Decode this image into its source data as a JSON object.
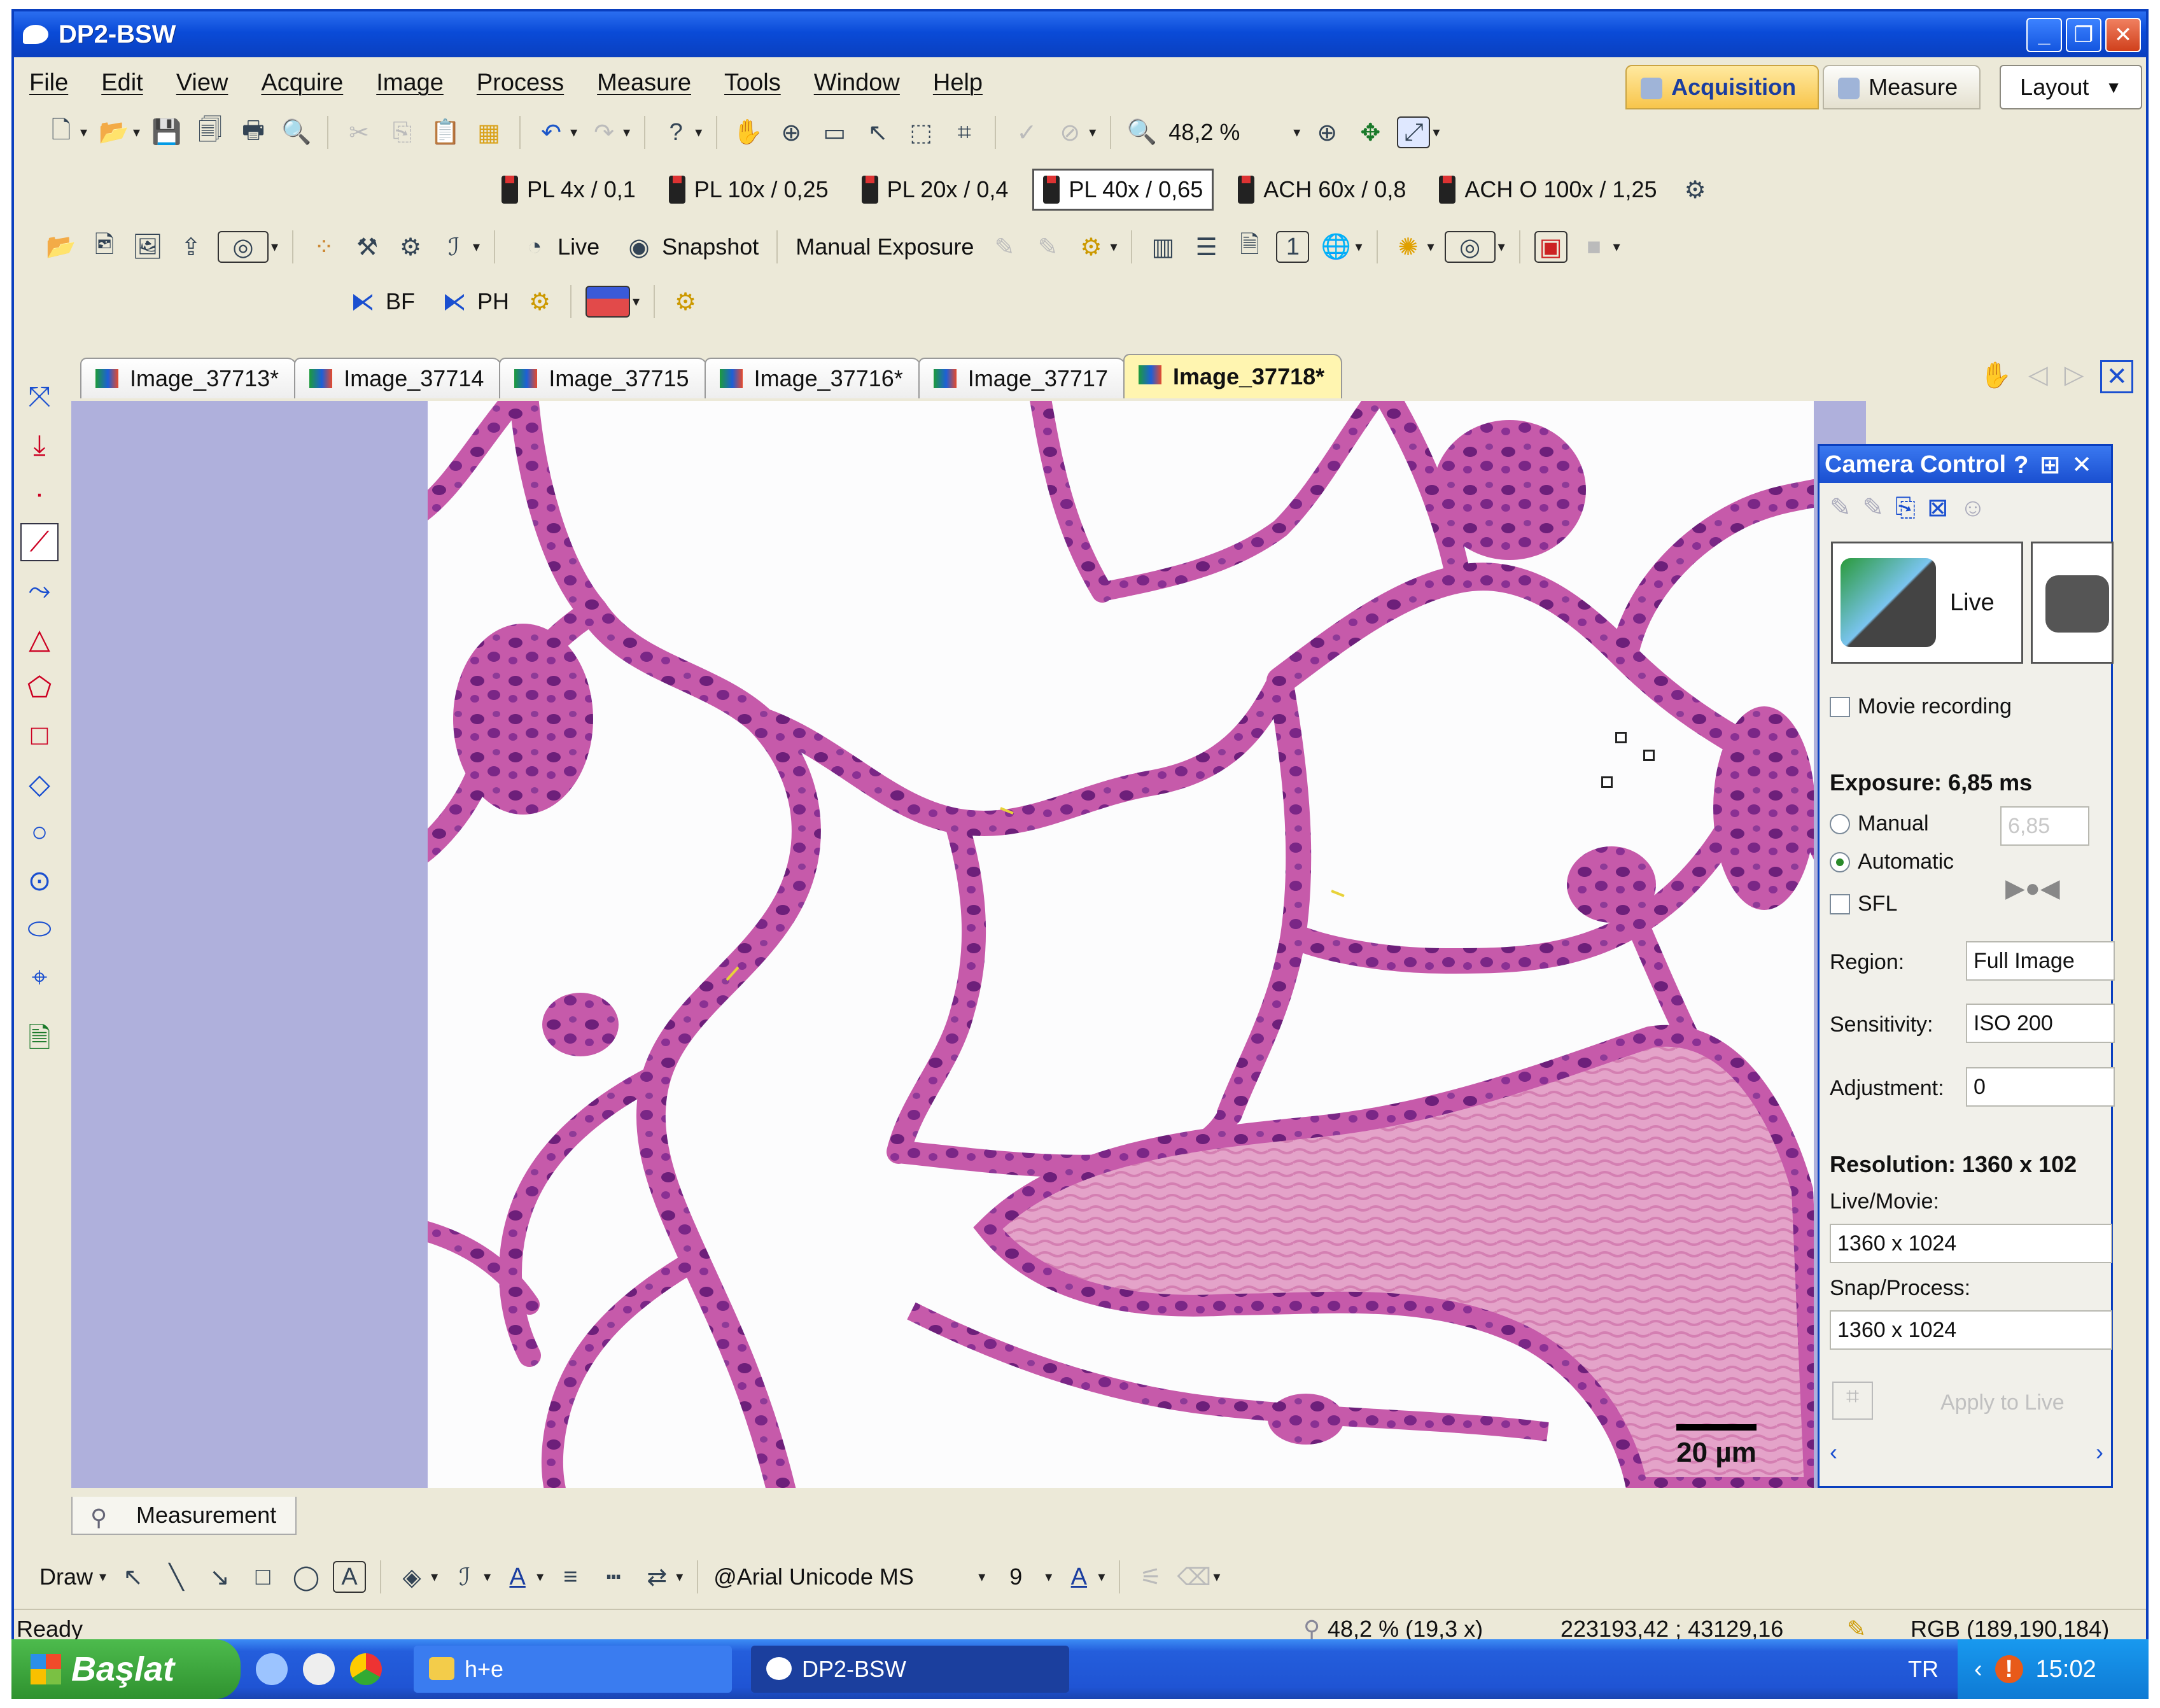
{
  "window": {
    "title": "DP2-BSW"
  },
  "menu": [
    "File",
    "Edit",
    "View",
    "Acquire",
    "Image",
    "Process",
    "Measure",
    "Tools",
    "Window",
    "Help"
  ],
  "mode_tabs": {
    "acquisition": "Acquisition",
    "measure": "Measure",
    "layout": "Layout"
  },
  "zoom_toolbar": {
    "zoom": "48,2 %"
  },
  "objectives": [
    "PL 4x / 0,1",
    "PL 10x / 0,25",
    "PL 20x / 0,4",
    "PL 40x / 0,65",
    "ACH 60x / 0,8",
    "ACH O 100x / 1,25"
  ],
  "selected_objective": "PL 40x / 0,65",
  "acq_toolbar": {
    "live": "Live",
    "snapshot": "Snapshot",
    "manual_exposure": "Manual Exposure"
  },
  "obs_toolbar": {
    "bf": "BF",
    "ph": "PH"
  },
  "doc_tabs": [
    "Image_37713*",
    "Image_37714",
    "Image_37715",
    "Image_37716*",
    "Image_37717",
    "Image_37718*"
  ],
  "active_doc_tab": "Image_37718*",
  "image": {
    "scale_bar": "20 µm"
  },
  "camera_control": {
    "title": "Camera Control",
    "live_label": "Live",
    "movie_recording": "Movie recording",
    "exposure_header": "Exposure: 6,85 ms",
    "manual": "Manual",
    "manual_value": "6,85",
    "automatic": "Automatic",
    "sfl": "SFL",
    "region_label": "Region:",
    "region_value": "Full Image",
    "sensitivity_label": "Sensitivity:",
    "sensitivity_value": "ISO 200",
    "adjustment_label": "Adjustment:",
    "adjustment_value": "0",
    "resolution_header": "Resolution: 1360 x 102",
    "live_movie_label": "Live/Movie:",
    "live_movie_value": "1360 x 1024",
    "snap_process_label": "Snap/Process:",
    "snap_process_value": "1360 x 1024",
    "apply_to_live": "Apply to Live"
  },
  "measurement_tab": "Measurement",
  "draw_toolbar": {
    "draw": "Draw",
    "font": "@Arial Unicode MS",
    "font_size": "9"
  },
  "status": {
    "ready": "Ready",
    "zoom": "48,2 % (19,3 x)",
    "coords": "223193,42  ;  43129,16",
    "rgb": "RGB (189,190,184)"
  },
  "taskbar": {
    "start": "Başlat",
    "tasks": [
      "h+e",
      "DP2-BSW"
    ],
    "lang": "TR",
    "clock": "15:02"
  },
  "colors": {
    "titlebar": "#0a3fbf",
    "active_tab": "#fff5b0",
    "tissue": "#a8338f",
    "taskbar": "#245edc",
    "start": "#2f922f"
  }
}
